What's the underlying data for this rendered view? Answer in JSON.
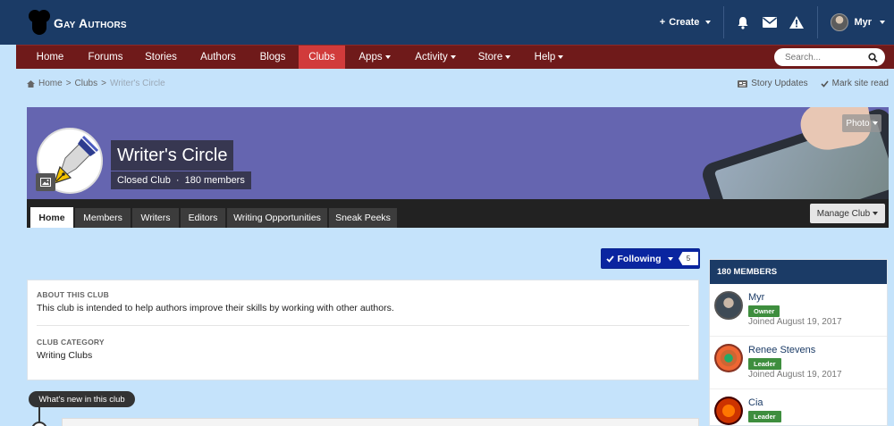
{
  "header": {
    "logo_text": "Gay Authors",
    "create_label": "Create",
    "user_name": "Myr"
  },
  "nav": {
    "items": [
      {
        "label": "Home",
        "caret": false
      },
      {
        "label": "Forums",
        "caret": false
      },
      {
        "label": "Stories",
        "caret": false
      },
      {
        "label": "Authors",
        "caret": false
      },
      {
        "label": "Blogs",
        "caret": false
      },
      {
        "label": "Clubs",
        "caret": false,
        "active": true
      },
      {
        "label": "Apps",
        "caret": true
      },
      {
        "label": "Activity",
        "caret": true
      },
      {
        "label": "Store",
        "caret": true
      },
      {
        "label": "Help",
        "caret": true
      }
    ],
    "search_placeholder": "Search..."
  },
  "breadcrumb": {
    "home": "Home",
    "clubs": "Clubs",
    "current": "Writer's Circle"
  },
  "top_links": {
    "story_updates": "Story Updates",
    "mark_read": "Mark site read"
  },
  "club": {
    "name": "Writer's Circle",
    "type": "Closed Club",
    "separator": "·",
    "members_count": "180 members",
    "photo_label": "Photo",
    "manage_label": "Manage Club"
  },
  "tabs": [
    "Home",
    "Members",
    "Writers",
    "Editors",
    "Writing Opportunities",
    "Sneak Peeks"
  ],
  "following": {
    "label": "Following",
    "count": "5"
  },
  "about": {
    "heading": "ABOUT THIS CLUB",
    "text": "This club is intended to help authors improve their skills by working with other authors.",
    "category_heading": "CLUB CATEGORY",
    "category": "Writing Clubs"
  },
  "whats_new": "What's new in this club",
  "members": {
    "heading": "180 MEMBERS",
    "list": [
      {
        "name": "Myr",
        "role": "Owner",
        "joined": "Joined August 19, 2017"
      },
      {
        "name": "Renee Stevens",
        "role": "Leader",
        "joined": "Joined August 19, 2017"
      },
      {
        "name": "Cia",
        "role": "Leader",
        "joined": ""
      }
    ]
  },
  "colors": {
    "header": "#1b3b66",
    "nav": "#6f1a1a",
    "nav_active": "#d13b3b",
    "banner": "#6565b0",
    "following": "#0a25a0",
    "badge": "#3e8e3e",
    "page_bg": "#c5e3fb"
  }
}
